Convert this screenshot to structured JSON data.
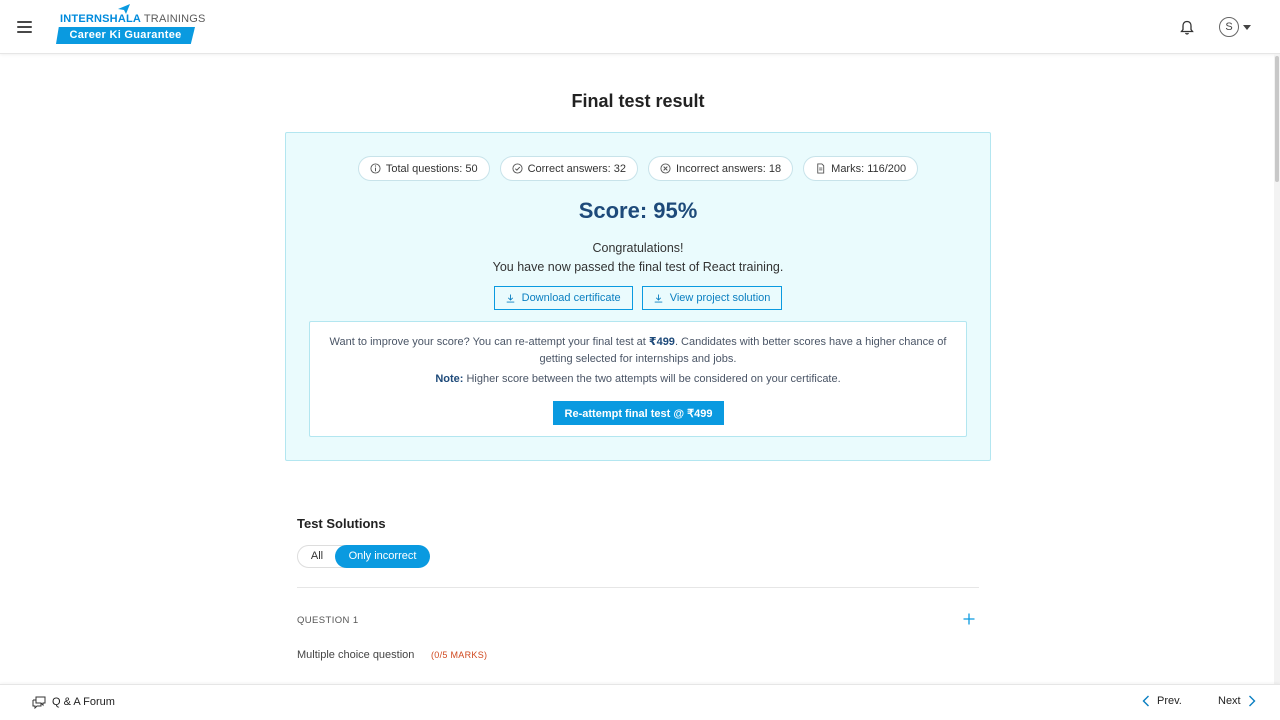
{
  "header": {
    "logo_brand": "INTERNSHALA",
    "logo_trainings": "TRAININGS",
    "logo_tagline": "Career Ki Guarantee",
    "avatar_initial": "S"
  },
  "main": {
    "title": "Final test result",
    "stats": [
      {
        "icon": "info-icon",
        "label": "Total questions: 50"
      },
      {
        "icon": "check-circle-icon",
        "label": "Correct answers: 32"
      },
      {
        "icon": "x-circle-icon",
        "label": "Incorrect answers: 18"
      },
      {
        "icon": "document-icon",
        "label": "Marks: 116/200"
      }
    ],
    "score": "Score: 95%",
    "congrats_line1": "Congratulations!",
    "congrats_line2": "You have now passed the final test of React training.",
    "download_certificate": "Download certificate",
    "view_project_solution": "View project solution",
    "improve_text_before": "Want to improve your score? You can re-attempt your final test at ",
    "improve_price": "₹499",
    "improve_text_after": ". Candidates with better scores have a higher chance of getting selected for internships and jobs.",
    "note_label": "Note:",
    "note_text": " Higher score between the two attempts will be considered on your certificate.",
    "reattempt_button": "Re-attempt final test @ ₹499"
  },
  "solutions": {
    "title": "Test Solutions",
    "filter_all": "All",
    "filter_incorrect": "Only incorrect",
    "filter_selected": "Only incorrect",
    "question_label": "QUESTION 1",
    "question_type": "Multiple choice question",
    "question_marks": "(0/5 MARKS)"
  },
  "footer": {
    "forum": "Q & A Forum",
    "prev": "Prev.",
    "next": "Next"
  },
  "colors": {
    "accent": "#0a9ae0",
    "score_text": "#1e4a7a",
    "card_bg": "#eafbfd",
    "marks_red": "#d0481e"
  }
}
